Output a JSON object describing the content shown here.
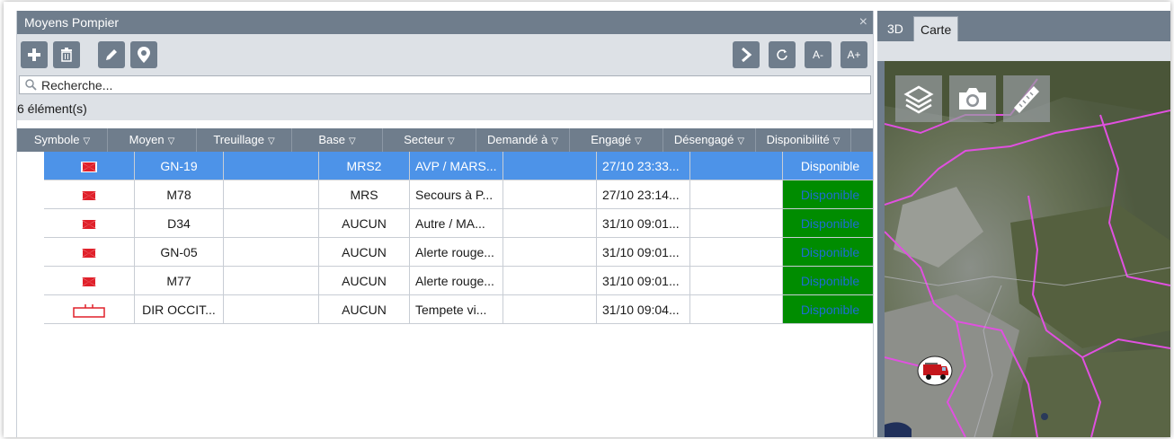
{
  "panel": {
    "title": "Moyens Pompier",
    "close_glyph": "×"
  },
  "toolbar": {
    "add_icon": "plus-icon",
    "delete_icon": "trash-icon",
    "edit_icon": "pencil-icon",
    "locate_icon": "map-pin-icon",
    "next_icon": "chevron-right-icon",
    "refresh_icon": "refresh-icon",
    "font_smaller": "A-",
    "font_larger": "A+"
  },
  "search": {
    "placeholder": "Recherche..."
  },
  "count_label": "6 élément(s)",
  "columns": [
    {
      "label": "Symbole"
    },
    {
      "label": "Moyen"
    },
    {
      "label": "Treuillage"
    },
    {
      "label": "Base"
    },
    {
      "label": "Secteur"
    },
    {
      "label": "Demandé à"
    },
    {
      "label": "Engagé"
    },
    {
      "label": "Désengagé"
    },
    {
      "label": "Disponibilité"
    }
  ],
  "rows": [
    {
      "symbol": "vehicle-symbol-icon",
      "moyen": "GN-19",
      "treuillage": "",
      "base": "MRS2",
      "secteur": "AVP / MARS...",
      "demande": "",
      "engage": "27/10 23:33...",
      "desengage": "",
      "dispo": "Disponible",
      "selected": true
    },
    {
      "symbol": "vehicle-symbol-icon",
      "moyen": "M78",
      "treuillage": "",
      "base": "MRS",
      "secteur": "Secours à P...",
      "demande": "",
      "engage": "27/10 23:14...",
      "desengage": "",
      "dispo": "Disponible",
      "selected": false
    },
    {
      "symbol": "vehicle-symbol-icon",
      "moyen": "D34",
      "treuillage": "",
      "base": "AUCUN",
      "secteur": "Autre / MA...",
      "demande": "",
      "engage": "31/10 09:01...",
      "desengage": "",
      "dispo": "Disponible",
      "selected": false
    },
    {
      "symbol": "vehicle-symbol-icon",
      "moyen": "GN-05",
      "treuillage": "",
      "base": "AUCUN",
      "secteur": "Alerte rouge...",
      "demande": "",
      "engage": "31/10 09:01...",
      "desengage": "",
      "dispo": "Disponible",
      "selected": false
    },
    {
      "symbol": "vehicle-symbol-icon",
      "moyen": "M77",
      "treuillage": "",
      "base": "AUCUN",
      "secteur": "Alerte rouge...",
      "demande": "",
      "engage": "31/10 09:01...",
      "desengage": "",
      "dispo": "Disponible",
      "selected": false
    },
    {
      "symbol": "command-symbol-icon",
      "moyen": "DIR OCCIT...",
      "treuillage": "",
      "base": "AUCUN",
      "secteur": "Tempete vi...",
      "demande": "",
      "engage": "31/10 09:04...",
      "desengage": "",
      "dispo": "Disponible",
      "selected": false
    }
  ],
  "map_panel": {
    "tab_3d": "3D",
    "tab_carte": "Carte",
    "layers_icon": "layers-icon",
    "camera_icon": "camera-icon",
    "ruler_icon": "ruler-icon",
    "vehicle_marker_icon": "fire-truck-icon"
  },
  "colors": {
    "header_slate": "#6f7d8c",
    "selection_blue": "#4d93e8",
    "available_green": "#008c00",
    "symbol_red": "#e0202a",
    "boundary_magenta": "#e050e0"
  }
}
